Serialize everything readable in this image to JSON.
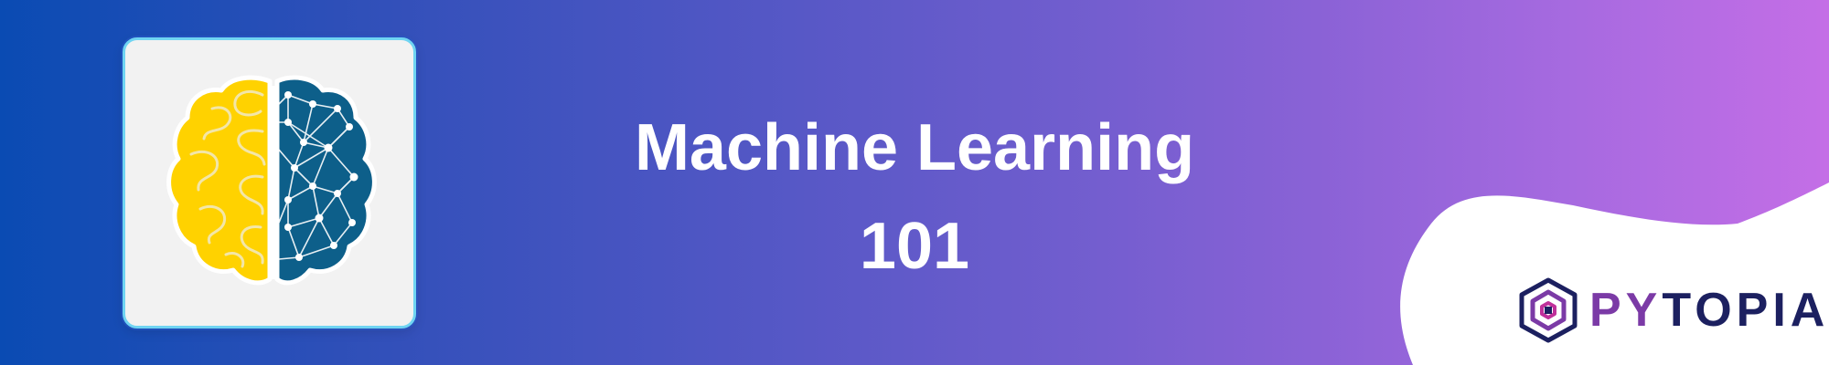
{
  "banner": {
    "title_line1": "Machine Learning",
    "title_line2": "101"
  },
  "logo": {
    "text": "PYTOPIA",
    "icon": "hexagon-logo-icon"
  },
  "card": {
    "icon": "brain-network-icon"
  },
  "colors": {
    "gradient_start": "#0a4bb3",
    "gradient_end": "#c46ee6",
    "brain_left": "#ffd200",
    "brain_right": "#0d5f8a",
    "logo_dark": "#1c2060",
    "logo_purple": "#7b3aa6",
    "card_border": "#6fd4f2"
  }
}
